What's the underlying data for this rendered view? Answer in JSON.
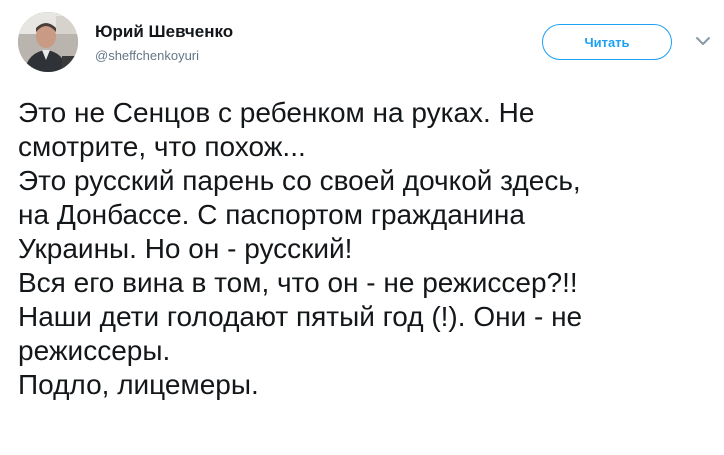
{
  "author": {
    "name": "Юрий Шевченко",
    "handle": "@sheffchenkoyuri"
  },
  "actions": {
    "follow_label": "Читать"
  },
  "icons": {
    "more": "chevron-down-icon",
    "avatar": "profile-photo"
  },
  "colors": {
    "accent": "#1da1f2",
    "text": "#14171a",
    "muted": "#657786"
  },
  "tweet": {
    "lines": [
      "Это не Сенцов с ребенком на руках. Не",
      "смотрите, что похож...",
      "Это русский парень со своей дочкой здесь,",
      "на Донбассе. С паспортом гражданина",
      "Украины. Но он - русский!",
      "Вся его вина в том, что он - не режиссер?!!",
      "Наши дети голодают пятый год (!). Они - не",
      "режиссеры.",
      "Подло, лицемеры."
    ]
  }
}
